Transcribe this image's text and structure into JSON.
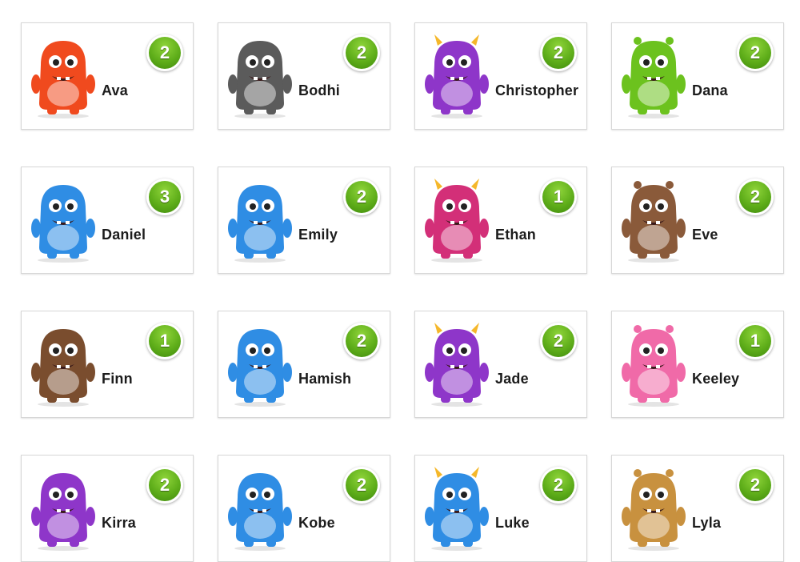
{
  "students": [
    {
      "name": "Ava",
      "points": "2",
      "avatar": "monster-orange-icon",
      "color": "#f04a1e"
    },
    {
      "name": "Bodhi",
      "points": "2",
      "avatar": "monster-gray-icon",
      "color": "#5b5b5b"
    },
    {
      "name": "Christopher",
      "points": "2",
      "avatar": "monster-purple-icon",
      "color": "#8e36c9"
    },
    {
      "name": "Dana",
      "points": "2",
      "avatar": "monster-green-icon",
      "color": "#6cc21e"
    },
    {
      "name": "Daniel",
      "points": "3",
      "avatar": "monster-blue-icon",
      "color": "#2f8de4"
    },
    {
      "name": "Emily",
      "points": "2",
      "avatar": "monster-blue-icon",
      "color": "#2f8de4"
    },
    {
      "name": "Ethan",
      "points": "1",
      "avatar": "monster-pink-icon",
      "color": "#d32f78"
    },
    {
      "name": "Eve",
      "points": "2",
      "avatar": "monster-brown-icon",
      "color": "#8a5a3a"
    },
    {
      "name": "Finn",
      "points": "1",
      "avatar": "monster-brown-icon",
      "color": "#7a4d2e"
    },
    {
      "name": "Hamish",
      "points": "2",
      "avatar": "monster-blue-icon",
      "color": "#2f8de4"
    },
    {
      "name": "Jade",
      "points": "2",
      "avatar": "monster-purple-icon",
      "color": "#8e36c9"
    },
    {
      "name": "Keeley",
      "points": "1",
      "avatar": "monster-pink-icon",
      "color": "#f06aa8"
    },
    {
      "name": "Kirra",
      "points": "2",
      "avatar": "monster-purple-icon",
      "color": "#8e36c9"
    },
    {
      "name": "Kobe",
      "points": "2",
      "avatar": "monster-blue-icon",
      "color": "#2f8de4"
    },
    {
      "name": "Luke",
      "points": "2",
      "avatar": "monster-blue-icon",
      "color": "#2f8de4"
    },
    {
      "name": "Lyla",
      "points": "2",
      "avatar": "monster-calico-icon",
      "color": "#c8913f"
    }
  ]
}
